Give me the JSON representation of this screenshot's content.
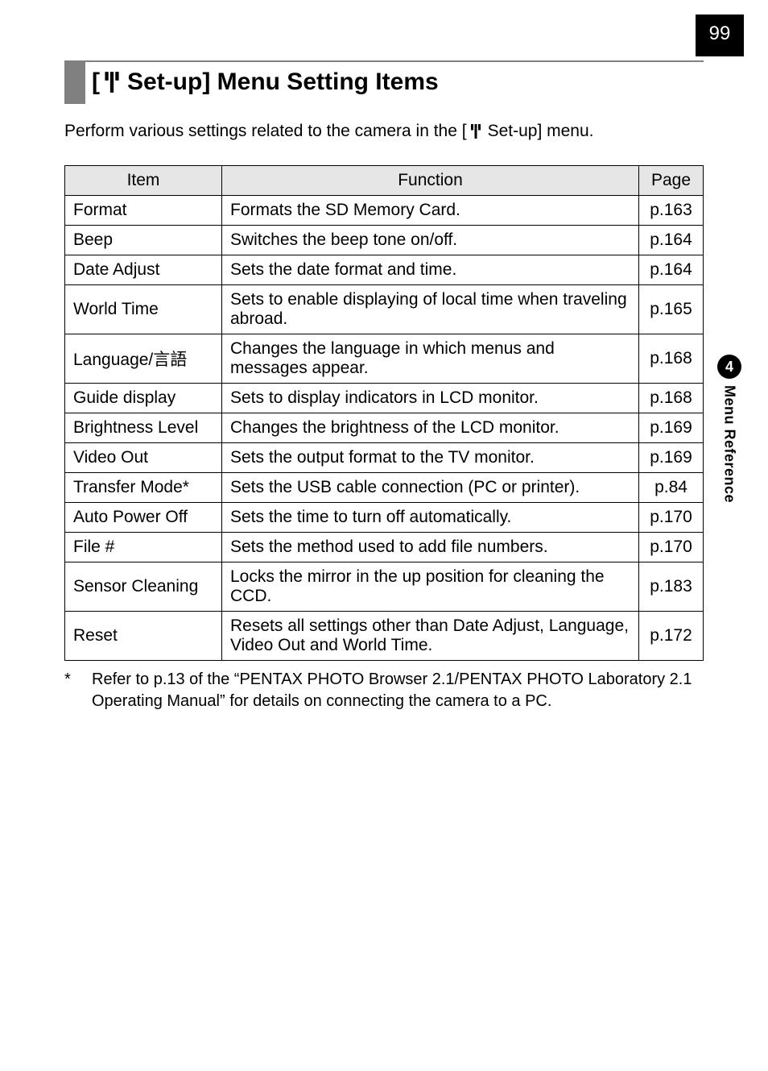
{
  "page_number": "99",
  "heading": {
    "prefix": "[",
    "title": " Set-up] Menu Setting Items"
  },
  "intro": {
    "before": "Perform various settings related to the camera in the [",
    "after": " Set-up] menu."
  },
  "table": {
    "headers": {
      "item": "Item",
      "function": "Function",
      "page": "Page"
    },
    "rows": [
      {
        "item": "Format",
        "function": "Formats the SD Memory Card.",
        "page": "p.163"
      },
      {
        "item": "Beep",
        "function": "Switches the beep tone on/off.",
        "page": "p.164"
      },
      {
        "item": "Date Adjust",
        "function": "Sets the date format and time.",
        "page": "p.164"
      },
      {
        "item": "World Time",
        "function": "Sets to enable displaying of local time when traveling abroad.",
        "page": "p.165"
      },
      {
        "item": "Language/言語",
        "function": "Changes the language in which menus and messages appear.",
        "page": "p.168"
      },
      {
        "item": "Guide display",
        "function": "Sets to display indicators in LCD monitor.",
        "page": "p.168"
      },
      {
        "item": "Brightness Level",
        "function": "Changes the brightness of the LCD monitor.",
        "page": "p.169"
      },
      {
        "item": "Video Out",
        "function": "Sets the output format to the TV monitor.",
        "page": "p.169"
      },
      {
        "item": "Transfer Mode*",
        "function": "Sets the USB cable connection (PC or printer).",
        "page": "p.84"
      },
      {
        "item": "Auto Power Off",
        "function": "Sets the time to turn off automatically.",
        "page": "p.170"
      },
      {
        "item": "File #",
        "function": "Sets the method used to add file numbers.",
        "page": "p.170"
      },
      {
        "item": "Sensor Cleaning",
        "function": "Locks the mirror in the up position for cleaning the CCD.",
        "page": "p.183"
      },
      {
        "item": "Reset",
        "function": "Resets all settings other than Date Adjust, Language, Video Out and World Time.",
        "page": "p.172"
      }
    ]
  },
  "footnote": {
    "marker": "*",
    "text": "Refer to p.13 of the “PENTAX PHOTO Browser 2.1/PENTAX PHOTO Laboratory 2.1 Operating Manual” for details on connecting the camera to a PC."
  },
  "side_tab": {
    "chapter": "4",
    "label": "Menu Reference"
  }
}
